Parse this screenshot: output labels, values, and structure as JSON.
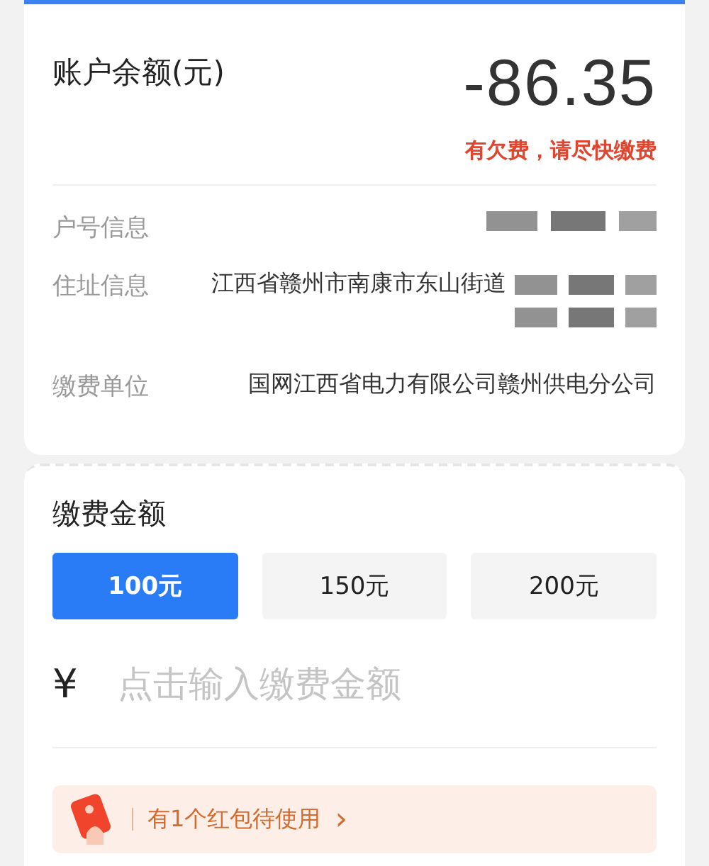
{
  "balance": {
    "label": "账户余额(元)",
    "amount": "-86.35",
    "notice": "有欠费，请尽快缴费"
  },
  "info_rows": [
    {
      "label": "户号信息",
      "redacted": true
    },
    {
      "label": "住址信息",
      "value": "江西省赣州市南康市东山街道",
      "redacted": true
    },
    {
      "label": "缴费单位",
      "value": "国网江西省电力有限公司赣州供电分公司",
      "redacted": false
    }
  ],
  "payment": {
    "title": "缴费金额",
    "options": [
      {
        "label": "100元",
        "selected": true
      },
      {
        "label": "150元",
        "selected": false
      },
      {
        "label": "200元",
        "selected": false
      }
    ],
    "currency": "¥",
    "amount_field": {
      "placeholder": "点击输入缴费金额"
    },
    "coupon": {
      "text": "有1个红包待使用",
      "arrow": "›"
    }
  }
}
